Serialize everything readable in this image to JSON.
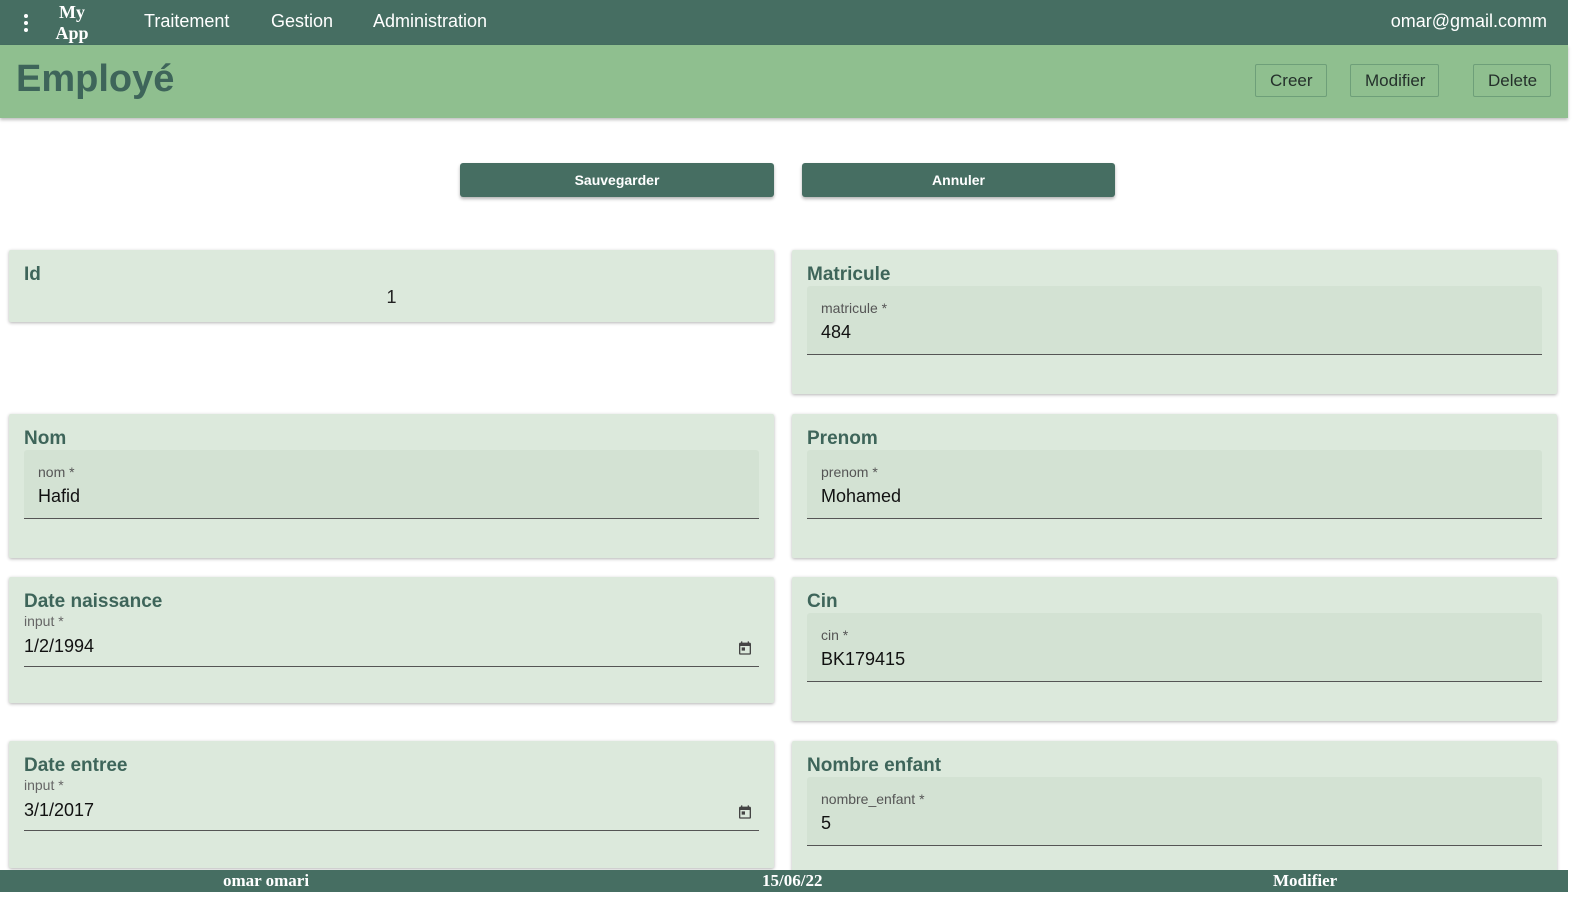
{
  "header": {
    "app_name": "My App",
    "nav": [
      "Traitement",
      "Gestion",
      "Administration"
    ],
    "user_email": "omar@gmail.comm"
  },
  "title_bar": {
    "title": "Employé",
    "buttons": [
      "Creer",
      "Modifier",
      "Delete"
    ]
  },
  "actions": {
    "save": "Sauvegarder",
    "cancel": "Annuler"
  },
  "form": {
    "id": {
      "label": "Id",
      "value": "1"
    },
    "matricule": {
      "label": "Matricule",
      "field_label": "matricule *",
      "value": "484"
    },
    "nom": {
      "label": "Nom",
      "field_label": "nom *",
      "value": "Hafid"
    },
    "prenom": {
      "label": "Prenom",
      "field_label": "prenom *",
      "value": "Mohamed"
    },
    "date_naissance": {
      "label": "Date naissance",
      "field_label": "input *",
      "value": "1/2/1994"
    },
    "cin": {
      "label": "Cin",
      "field_label": "cin *",
      "value": "BK179415"
    },
    "date_entree": {
      "label": "Date entree",
      "field_label": "input *",
      "value": "3/1/2017"
    },
    "nombre_enfant": {
      "label": "Nombre enfant",
      "field_label": "nombre_enfant *",
      "value": "5"
    }
  },
  "footer": {
    "user_name": "omar omari",
    "date": "15/06/22",
    "mode": "Modifier"
  },
  "colors": {
    "header_bg": "#466e62",
    "title_bg": "#8fbf8f",
    "card_bg": "#dce9dc",
    "field_bg": "#d3e2d3",
    "accent_text": "#3e655a"
  },
  "icons": [
    "more-vert-icon",
    "calendar-icon"
  ]
}
